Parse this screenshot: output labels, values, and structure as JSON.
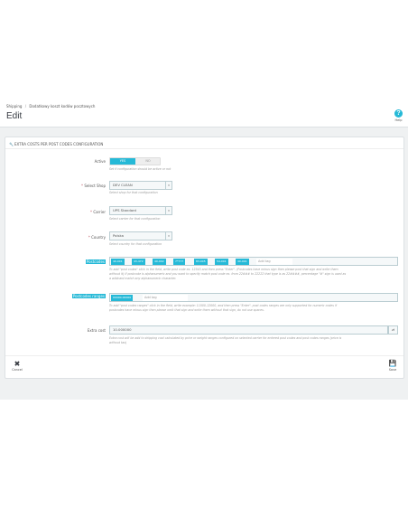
{
  "breadcrumb": [
    "Shipping",
    "Dodatkowy koszt kodów pocztowych"
  ],
  "page_title": "Edit",
  "help": {
    "icon": "?",
    "label": "Help"
  },
  "panel": {
    "heading": "EXTRA COSTS PER POST CODES CONFIGURATION"
  },
  "active": {
    "label": "Active",
    "on": "YES",
    "off": "NO",
    "help": "Set if configuration should be active or not"
  },
  "shop": {
    "label": "Select Shop",
    "value": "DEV CLEAN",
    "help": "Select shop for that configuration"
  },
  "carrier": {
    "label": "Carrier",
    "value": "UPS Standard",
    "help": "Select carrier for that configuration"
  },
  "country": {
    "label": "Country",
    "value": "Polska",
    "help": "Select country for that configuration"
  },
  "postcodes": {
    "label": "Postcodes",
    "tags": [
      "40-001",
      "43-472",
      "40-002",
      "7*777",
      "83-005",
      "54-001",
      "40-001"
    ],
    "add_placeholder": "Add tag",
    "help_lines": [
      "To add \"post codes\" click in the field, write post code ex. 12345 and then press \"Enter\". (Postcodes have minus sign then please post that sign and write them",
      "without it) If postcode is alphanumeric and you want to specify match post code ex. from 22### to 22222 that type is as 22####, percentage \"#\" sign is used as",
      "a wildcard match any alphanumeric character."
    ]
  },
  "ranges": {
    "label": "Postcodes ranges",
    "tags": [
      "00000-00000"
    ],
    "add_placeholder": "Add tag",
    "help_lines": [
      "To add \"post codes ranges\" click in the field, write example: 11000-12000, and then press \"Enter\". post codes ranges are only supported for numeric codes if",
      "postcodes have minus sign then please omit that sign and write them without that sign, do not use spaces."
    ]
  },
  "extra_cost": {
    "label": "Extra cost",
    "value": "10.000000",
    "suffix": "zł",
    "help_lines": [
      "Extra cost will be add to shipping cost calculated by price or weight ranges configured on selected carrier for entered post codes and post codes ranges (price is",
      "without tax)"
    ]
  },
  "footer": {
    "cancel_icon": "✖",
    "cancel_label": "Cancel",
    "save_icon": "💾",
    "save_label": "Save"
  }
}
